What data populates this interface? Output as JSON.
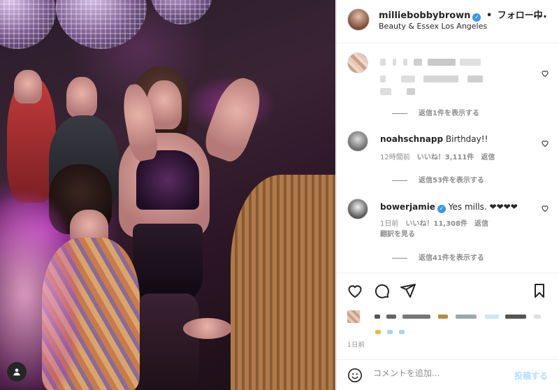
{
  "post": {
    "author": "milliebobbybrown",
    "separator": "•",
    "follow_status": "フォロー中",
    "location": "Beauty & Essex Los Angeles",
    "more_icon": "more-horizontal-icon"
  },
  "comments": [
    {
      "user": "",
      "text": "",
      "time": "",
      "likes": "",
      "reply": "",
      "view_replies": "返信1件を表示する",
      "obscured": true
    },
    {
      "user": "noahschnapp",
      "text": "Birthday!!",
      "time": "12時間前",
      "likes": "いいね！3,111件",
      "reply": "返信",
      "view_replies": "返信53件を表示する"
    },
    {
      "user": "bowerjamie",
      "verified": true,
      "text": "Yes mills. ❤❤❤❤",
      "time": "1日前",
      "likes": "いいね！11,308件",
      "reply": "返信",
      "translate": "翻訳を見る",
      "view_replies": "返信41件を表示する"
    }
  ],
  "actions": {
    "like_icon": "heart-icon",
    "comment_icon": "comment-icon",
    "share_icon": "paper-plane-icon",
    "save_icon": "bookmark-icon"
  },
  "date": "1日前",
  "composer": {
    "placeholder": "コメントを追加...",
    "post_label": "投稿する",
    "emoji_icon": "emoji-icon"
  },
  "colors": {
    "verified": "#3897f0",
    "muted": "#8e8e8e",
    "post_button": "#b2dffc"
  }
}
